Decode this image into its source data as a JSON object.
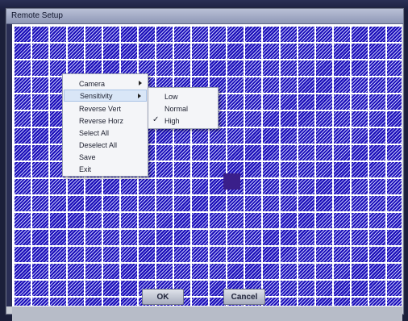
{
  "window": {
    "title": "Remote Setup"
  },
  "context_menu": {
    "items": [
      {
        "label": "Camera",
        "has_submenu": true
      },
      {
        "label": "Sensitivity",
        "has_submenu": true,
        "highlighted": true
      },
      {
        "label": "Reverse Vert"
      },
      {
        "label": "Reverse Horz"
      },
      {
        "label": "Select All"
      },
      {
        "label": "Deselect All"
      },
      {
        "label": "Save"
      },
      {
        "label": "Exit"
      }
    ]
  },
  "sensitivity_submenu": {
    "items": [
      {
        "label": "Low",
        "checked": false
      },
      {
        "label": "Normal",
        "checked": false
      },
      {
        "label": "High",
        "checked": true
      }
    ],
    "check_glyph": "✓"
  },
  "buttons": {
    "ok": "OK",
    "cancel": "Cancel"
  },
  "colors": {
    "grid_fill": "#1a0cb8",
    "grid_line": "#ffffff",
    "selected_cell": "#3a1f8a"
  }
}
